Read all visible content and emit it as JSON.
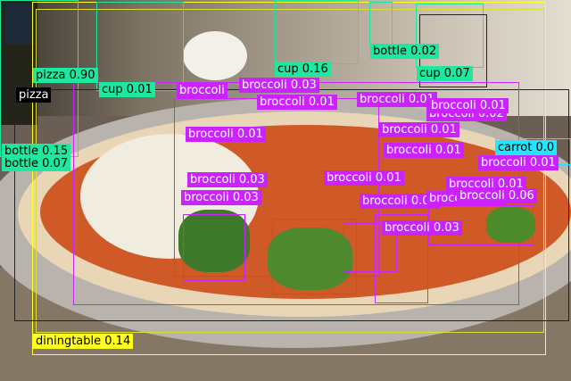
{
  "colors": {
    "pizza": "#ffffff",
    "bottle": "#1ee8a0",
    "cup": "#1ee8a0",
    "broccoli": "#cc22ff",
    "carrot": "#22e6ff",
    "diningtable": "#ffff22"
  },
  "detections": [
    {
      "label": "pizza 0.90",
      "cls": "bottle"
    },
    {
      "label": "pizza",
      "cls": "pizza"
    },
    {
      "label": "bottle 0.02",
      "cls": "bottle"
    },
    {
      "label": "cup 0.16",
      "cls": "cup"
    },
    {
      "label": "cup 0.07",
      "cls": "cup"
    },
    {
      "label": "cup 0.01",
      "cls": "cup"
    },
    {
      "label": "broccoli",
      "cls": "broccoli"
    },
    {
      "label": "broccoli 0.03",
      "cls": "broccoli"
    },
    {
      "label": "broccoli 0.01",
      "cls": "broccoli"
    },
    {
      "label": "broccoli 0.01",
      "cls": "broccoli"
    },
    {
      "label": "broccoli 0.02",
      "cls": "broccoli"
    },
    {
      "label": "broccoli 0.01",
      "cls": "broccoli"
    },
    {
      "label": "broccoli 0.01",
      "cls": "broccoli"
    },
    {
      "label": "broccoli 0.01",
      "cls": "broccoli"
    },
    {
      "label": "broccoli 0.01",
      "cls": "broccoli"
    },
    {
      "label": "broccoli 0.01",
      "cls": "broccoli"
    },
    {
      "label": "broccoli 0.03",
      "cls": "broccoli"
    },
    {
      "label": "broccoli 0.01",
      "cls": "broccoli"
    },
    {
      "label": "broccoli 0.03",
      "cls": "broccoli"
    },
    {
      "label": "broccoli 0.01",
      "cls": "broccoli"
    },
    {
      "label": "broccoli 0.01",
      "cls": "broccoli"
    },
    {
      "label": "broccoli 0.02",
      "cls": "broccoli"
    },
    {
      "label": "broccoli 0.06",
      "cls": "broccoli"
    },
    {
      "label": "broccoli 0.03",
      "cls": "broccoli"
    },
    {
      "label": "carrot 0.0",
      "cls": "carrot"
    },
    {
      "label": "bottle 0.15",
      "cls": "bottle"
    },
    {
      "label": "bottle 0.07",
      "cls": "bottle"
    },
    {
      "label": "diningtable 0.14",
      "cls": "diningtable"
    }
  ]
}
